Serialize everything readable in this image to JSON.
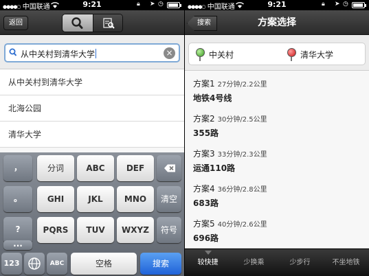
{
  "status": {
    "carrier": "中国联通",
    "time": "9:21",
    "battery_level": 0.9
  },
  "search_screen": {
    "back_label": "返回",
    "query": "从中关村到清华大学",
    "suggestions": [
      "从中关村到清华大学",
      "北海公园",
      "清华大学"
    ],
    "keyboard": {
      "comma": "，",
      "fenci": "分词",
      "abc": "ABC",
      "def": "DEF",
      "period": "。",
      "ghi": "GHI",
      "jkl": "JKL",
      "mno": "MNO",
      "clear": "清空",
      "question": "?",
      "pqrs": "PQRS",
      "tuv": "TUV",
      "wxyz": "WXYZ",
      "symbol": "符号",
      "ellipsis": "...",
      "num": "123",
      "abc_small": "ABC",
      "space": "空格",
      "search": "搜索"
    }
  },
  "route_screen": {
    "back_label": "搜索",
    "title": "方案选择",
    "start": "中关村",
    "end": "清华大学",
    "plans": [
      {
        "name": "方案1",
        "meta": "27分钟/2.2公里",
        "line": "地铁4号线"
      },
      {
        "name": "方案2",
        "meta": "30分钟/2.5公里",
        "line": "355路"
      },
      {
        "name": "方案3",
        "meta": "33分钟/2.3公里",
        "line": "运通110路"
      },
      {
        "name": "方案4",
        "meta": "36分钟/2.8公里",
        "line": "683路"
      },
      {
        "name": "方案5",
        "meta": "40分钟/2.6公里",
        "line": "696路"
      }
    ],
    "tabs": [
      "较快捷",
      "少换乘",
      "少步行",
      "不坐地铁"
    ]
  },
  "colors": {
    "search_key": "#1f62d8",
    "start_pin": "#3a9a1f",
    "end_pin": "#c91515"
  }
}
